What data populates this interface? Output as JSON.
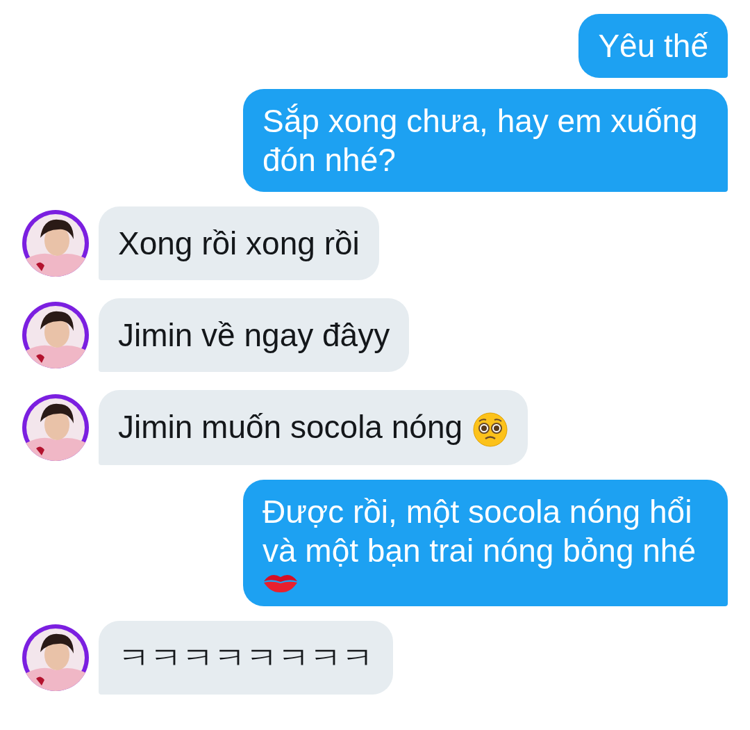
{
  "messages": [
    {
      "kind": "sent",
      "text": "Yêu thế"
    },
    {
      "kind": "sent",
      "text": "Sắp xong chưa, hay em xuống đón nhé?"
    },
    {
      "kind": "received",
      "text": "Xong rồi xong rồi"
    },
    {
      "kind": "received",
      "text": "Jimin về ngay đâyy"
    },
    {
      "kind": "received-emoji",
      "text": "Jimin muốn socola nóng"
    },
    {
      "kind": "sent-emoji",
      "text": "Được rồi, một socola nóng hổi và một bạn trai nóng bỏng nhé"
    },
    {
      "kind": "received",
      "text": "ㅋㅋㅋㅋㅋㅋㅋㅋ"
    }
  ]
}
